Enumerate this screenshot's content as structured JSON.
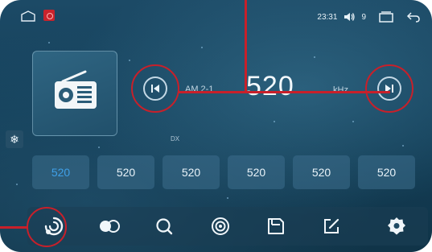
{
  "status_bar": {
    "time": "23:31",
    "volume": "9"
  },
  "tuner": {
    "band": "AM 2-1",
    "frequency": "520",
    "unit": "kHz",
    "dx_label": "DX"
  },
  "presets": [
    {
      "label": "520",
      "active": true
    },
    {
      "label": "520",
      "active": false
    },
    {
      "label": "520",
      "active": false
    },
    {
      "label": "520",
      "active": false
    },
    {
      "label": "520",
      "active": false
    },
    {
      "label": "520",
      "active": false
    }
  ],
  "colors": {
    "annotation": "#c8202a",
    "active_preset": "#3fa0e8"
  },
  "toolbar_icons": [
    "scan-icon",
    "toggle-icon",
    "search-icon",
    "broadcast-icon",
    "save-icon",
    "edit-icon",
    "settings-icon"
  ]
}
